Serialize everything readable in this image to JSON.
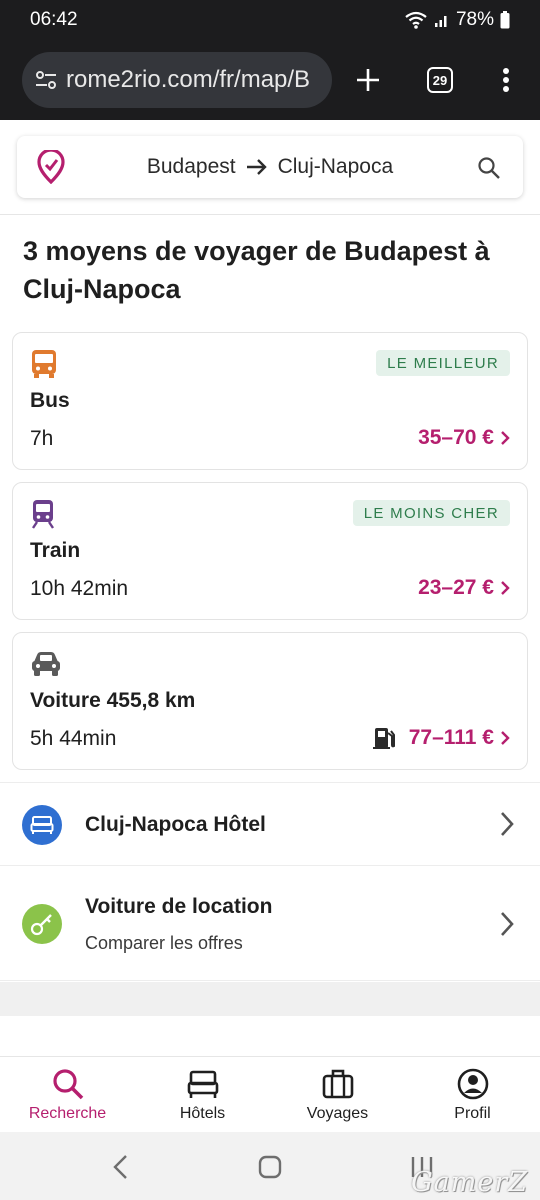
{
  "status_bar": {
    "time": "06:42",
    "battery": "78%"
  },
  "browser": {
    "url": "rome2rio.com/fr/map/B",
    "tab_count": "29"
  },
  "search": {
    "origin": "Budapest",
    "destination": "Cluj-Napoca"
  },
  "heading": "3 moyens de voyager de Budapest à Cluj-Napoca",
  "options": [
    {
      "icon": "bus-icon",
      "badge": "LE MEILLEUR",
      "title": "Bus",
      "duration": "7h",
      "price": "35–70 €"
    },
    {
      "icon": "train-icon",
      "badge": "LE MOINS CHER",
      "title": "Train",
      "duration": "10h 42min",
      "price": "23–27 €"
    },
    {
      "icon": "car-icon",
      "title": "Voiture 455,8 km",
      "duration": "5h 44min",
      "price": "77–111 €"
    }
  ],
  "hotel": {
    "title": "Cluj-Napoca Hôtel"
  },
  "car_rental": {
    "title": "Voiture de location",
    "subtitle": "Comparer les offres"
  },
  "bottom_nav": [
    {
      "label": "Recherche",
      "icon": "search-icon",
      "active": true
    },
    {
      "label": "Hôtels",
      "icon": "bed-icon"
    },
    {
      "label": "Voyages",
      "icon": "suitcase-icon"
    },
    {
      "label": "Profil",
      "icon": "profile-icon"
    }
  ],
  "watermark": "GamerZ",
  "colors": {
    "accent": "#b51f6e",
    "badge_bg": "#e4f1ea",
    "badge_text": "#2e7d4c",
    "bus": "#e07a2e",
    "train": "#6b3f8c",
    "hotel": "#2f6fd1",
    "rental": "#8bc34a"
  }
}
